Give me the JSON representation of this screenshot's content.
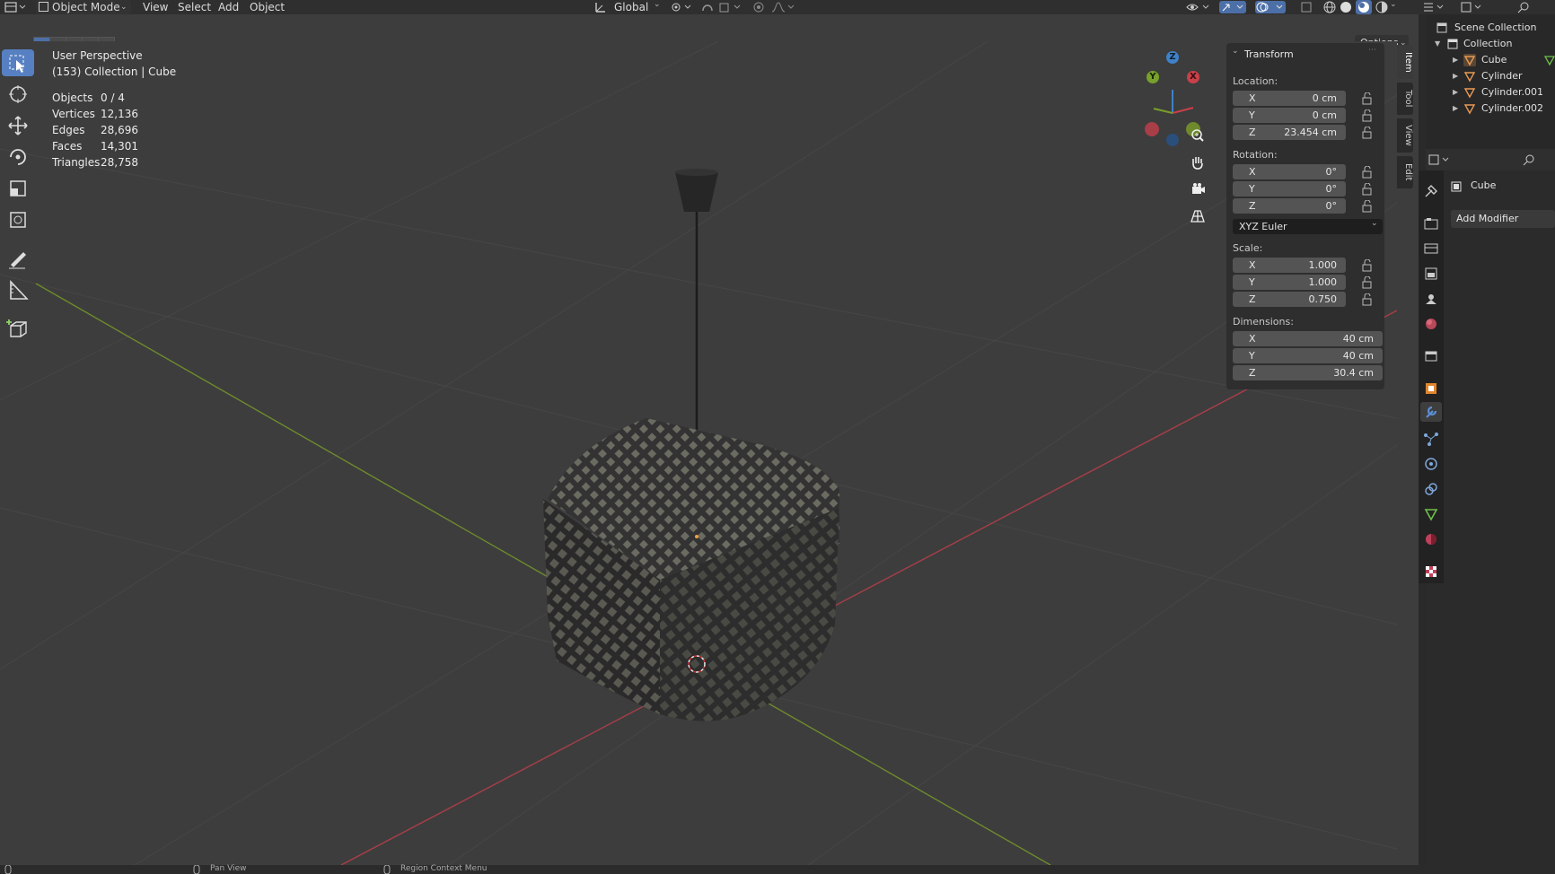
{
  "header": {
    "mode": "Object Mode",
    "menus": [
      "View",
      "Select",
      "Add",
      "Object"
    ],
    "transform_orientation": "Global",
    "options_label": "Options"
  },
  "viewport": {
    "view_name": "User Perspective",
    "context": "(153) Collection | Cube",
    "stats": [
      {
        "label": "Objects",
        "value": "0 / 4"
      },
      {
        "label": "Vertices",
        "value": "12,136"
      },
      {
        "label": "Edges",
        "value": "28,696"
      },
      {
        "label": "Faces",
        "value": "14,301"
      },
      {
        "label": "Triangles",
        "value": "28,758"
      }
    ],
    "gizmo_axes": {
      "x": "X",
      "y": "Y",
      "z": "Z"
    }
  },
  "npanel": {
    "section_title": "Transform",
    "location_label": "Location:",
    "location": [
      {
        "axis": "X",
        "value": "0 cm"
      },
      {
        "axis": "Y",
        "value": "0 cm"
      },
      {
        "axis": "Z",
        "value": "23.454 cm"
      }
    ],
    "rotation_label": "Rotation:",
    "rotation": [
      {
        "axis": "X",
        "value": "0°"
      },
      {
        "axis": "Y",
        "value": "0°"
      },
      {
        "axis": "Z",
        "value": "0°"
      }
    ],
    "rotation_mode": "XYZ Euler",
    "scale_label": "Scale:",
    "scale": [
      {
        "axis": "X",
        "value": "1.000"
      },
      {
        "axis": "Y",
        "value": "1.000"
      },
      {
        "axis": "Z",
        "value": "0.750"
      }
    ],
    "dimensions_label": "Dimensions:",
    "dimensions": [
      {
        "axis": "X",
        "value": "40 cm"
      },
      {
        "axis": "Y",
        "value": "40 cm"
      },
      {
        "axis": "Z",
        "value": "30.4 cm"
      }
    ],
    "tabs": [
      "Item",
      "Tool",
      "View",
      "Edit"
    ]
  },
  "outliner": {
    "root": "Scene Collection",
    "collection": "Collection",
    "items": [
      "Cube",
      "Cylinder",
      "Cylinder.001",
      "Cylinder.002"
    ]
  },
  "properties": {
    "object_name": "Cube",
    "add_modifier": "Add Modifier"
  },
  "statusbar": {
    "items": [
      "Pan View",
      "Region Context Menu"
    ]
  },
  "colors": {
    "active_blue": "#5680c2",
    "x_axis": "#c9404a",
    "y_axis": "#78a02a",
    "z_axis": "#3f82c9"
  }
}
